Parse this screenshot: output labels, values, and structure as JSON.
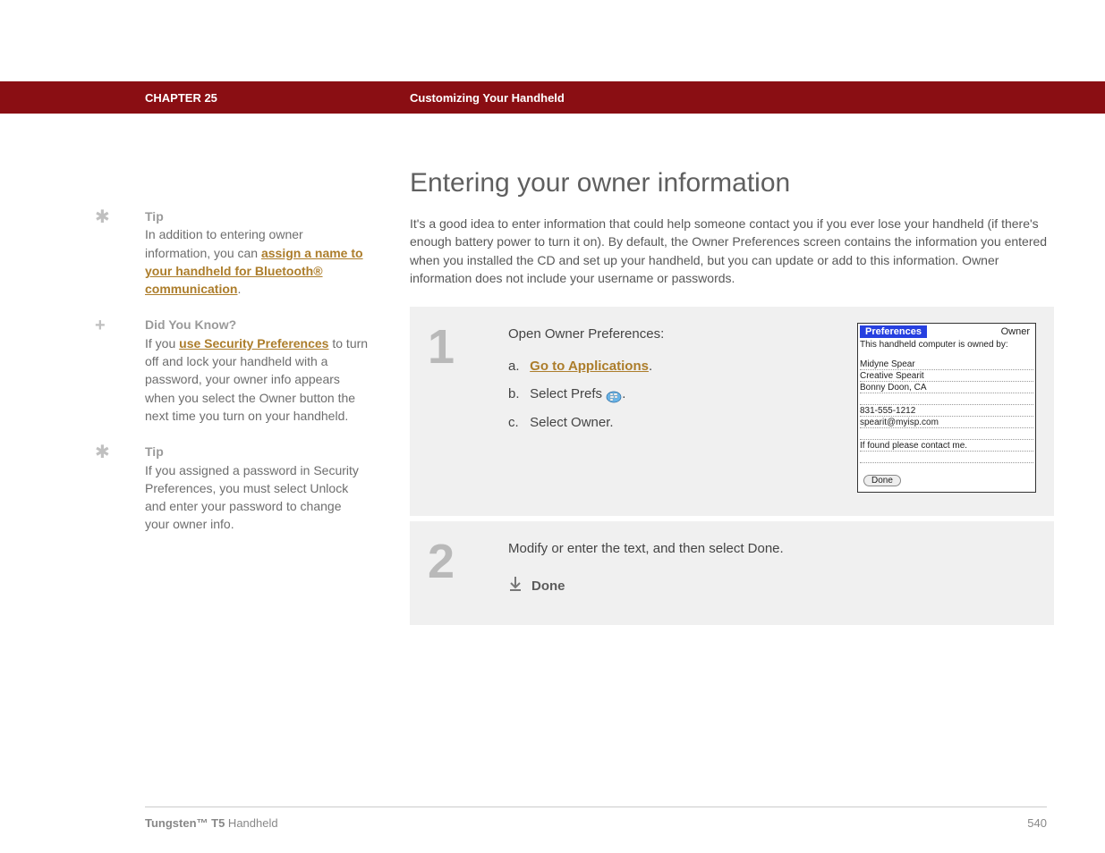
{
  "header": {
    "chapter": "CHAPTER 25",
    "title": "Customizing Your Handheld"
  },
  "sidebar": {
    "tip1": {
      "label": "Tip",
      "pre": "In addition to entering owner information, you can ",
      "link": "assign a name to your handheld for Bluetooth® communication",
      "post": "."
    },
    "didyouknow": {
      "label": "Did You Know?",
      "pre": "If you ",
      "link": "use Security Preferences",
      "post": " to turn off and lock your handheld with a password, your owner info appears when you select the Owner button the next time you turn on your handheld."
    },
    "tip2": {
      "label": "Tip",
      "body": "If you assigned a password in Security Preferences, you must select Unlock and enter your password to change your owner info."
    }
  },
  "main": {
    "title": "Entering your owner information",
    "intro": "It's a good idea to enter information that could help someone contact you if you ever lose your handheld (if there's enough battery power to turn it on). By default, the Owner Preferences screen contains the information you entered when you installed the CD and set up your handheld, but you can update or add to this information. Owner information does not include your username or passwords."
  },
  "step1": {
    "num": "1",
    "title": "Open Owner Preferences:",
    "a_letter": "a.",
    "a_link": "Go to Applications",
    "a_post": ".",
    "b_letter": "b.",
    "b_pre": "Select Prefs ",
    "b_post": ".",
    "c_letter": "c.",
    "c_text": "Select Owner."
  },
  "screenshot": {
    "pref": "Preferences",
    "owner": "Owner",
    "owned_by": "This handheld computer is owned by:",
    "l1": "Midyne Spear",
    "l2": "Creative Spearit",
    "l3": "Bonny Doon, CA",
    "l4": "831-555-1212",
    "l5": "spearit@myisp.com",
    "l6": "If found please contact me.",
    "done": "Done"
  },
  "step2": {
    "num": "2",
    "text": "Modify or enter the text, and then select Done.",
    "done": "Done"
  },
  "footer": {
    "product_bold": "Tungsten™ T5",
    "product_rest": " Handheld",
    "page": "540"
  }
}
